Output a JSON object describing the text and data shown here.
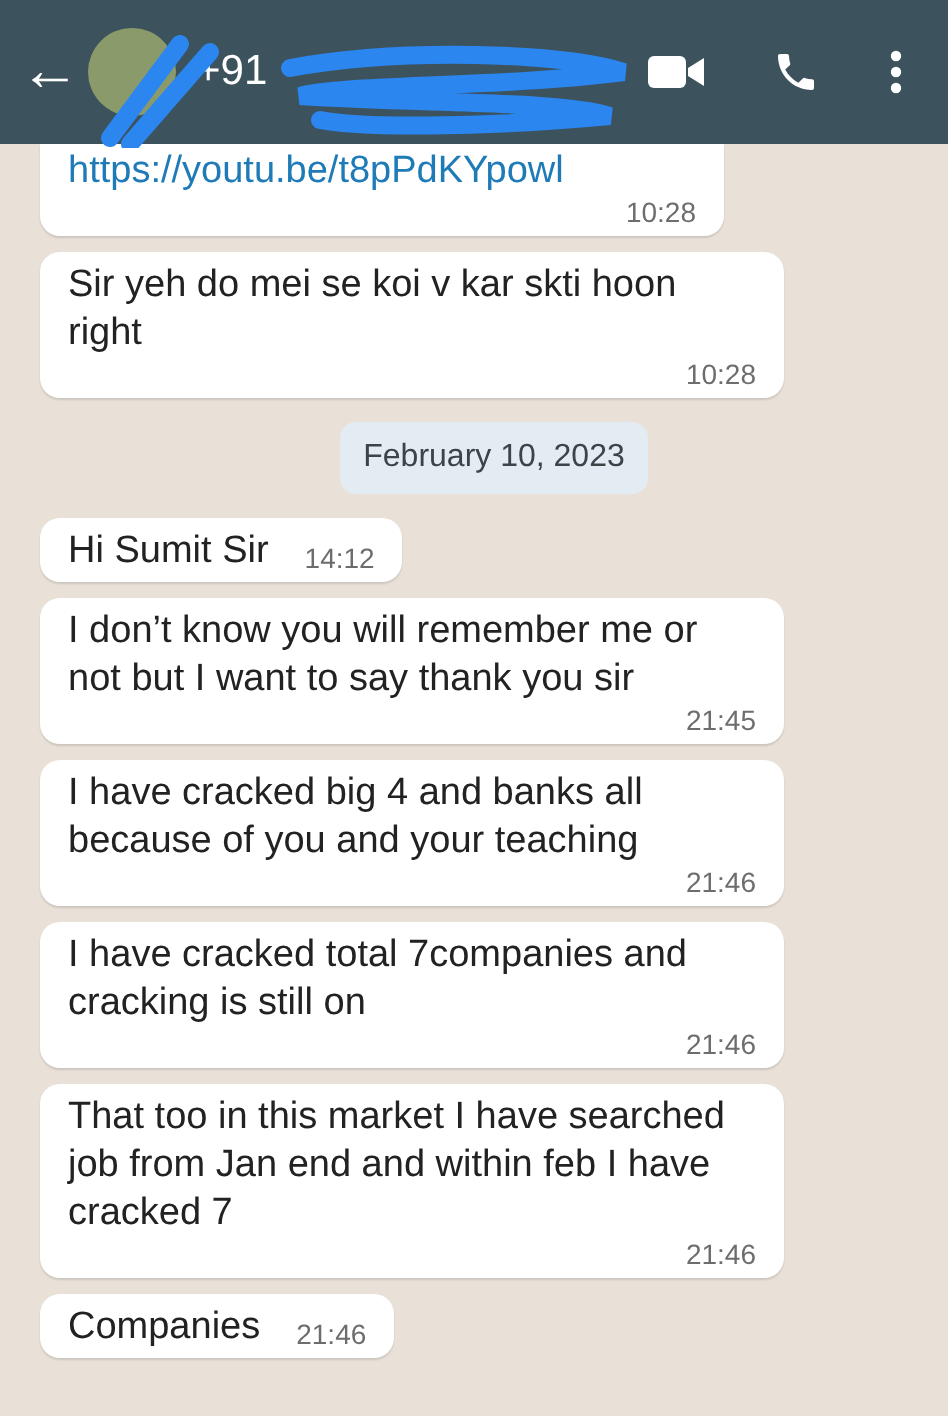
{
  "header": {
    "back": "←",
    "title": "+91"
  },
  "messages": [
    {
      "kind": "link",
      "text": "https://youtu.be/t8pPdKYpowl",
      "time": "10:28"
    },
    {
      "kind": "text",
      "text": "Sir yeh do mei se koi v kar skti hoon right",
      "time": "10:28"
    },
    {
      "kind": "date",
      "text": "February 10, 2023"
    },
    {
      "kind": "text",
      "text": "Hi Sumit Sir",
      "time": "14:12"
    },
    {
      "kind": "text",
      "text": "I don’t know you will remember me or not but I want to say thank you sir",
      "time": "21:45"
    },
    {
      "kind": "text",
      "text": "I have cracked big 4 and banks all because of you and your teaching",
      "time": "21:46"
    },
    {
      "kind": "text",
      "text": "I have cracked total 7companies and cracking is still on",
      "time": "21:46"
    },
    {
      "kind": "text",
      "text": "That too in this market I have searched job from Jan end and within feb I have cracked 7",
      "time": "21:46"
    },
    {
      "kind": "text",
      "text": "Companies",
      "time": "21:46"
    }
  ]
}
